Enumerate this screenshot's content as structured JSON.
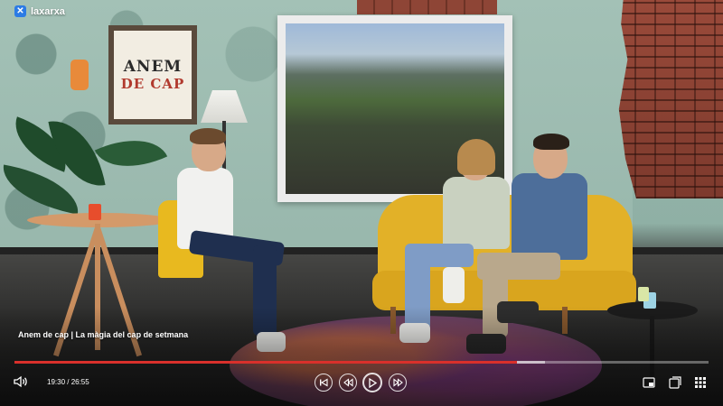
{
  "brand": {
    "logo_text": "laxarxa"
  },
  "scene": {
    "poster_line1": "ANEM",
    "poster_line2": "DE CAP"
  },
  "player": {
    "video_title": "Anem de cap | La màgia del cap de setmana",
    "time": "19:30 / 26:55",
    "progress": 0.724,
    "colors": {
      "progress": "#d9302b",
      "accent": "#2c7be5"
    },
    "controls": {
      "volume_icon": "volume-icon",
      "skip_back_icon": "skip-back-icon",
      "rewind_icon": "rewind-icon",
      "play_icon": "play-icon",
      "forward_icon": "fast-forward-icon",
      "pip_icon": "picture-in-picture-icon",
      "fullscreen_icon": "fullscreen-icon",
      "grid_icon": "grid-menu-icon"
    }
  }
}
